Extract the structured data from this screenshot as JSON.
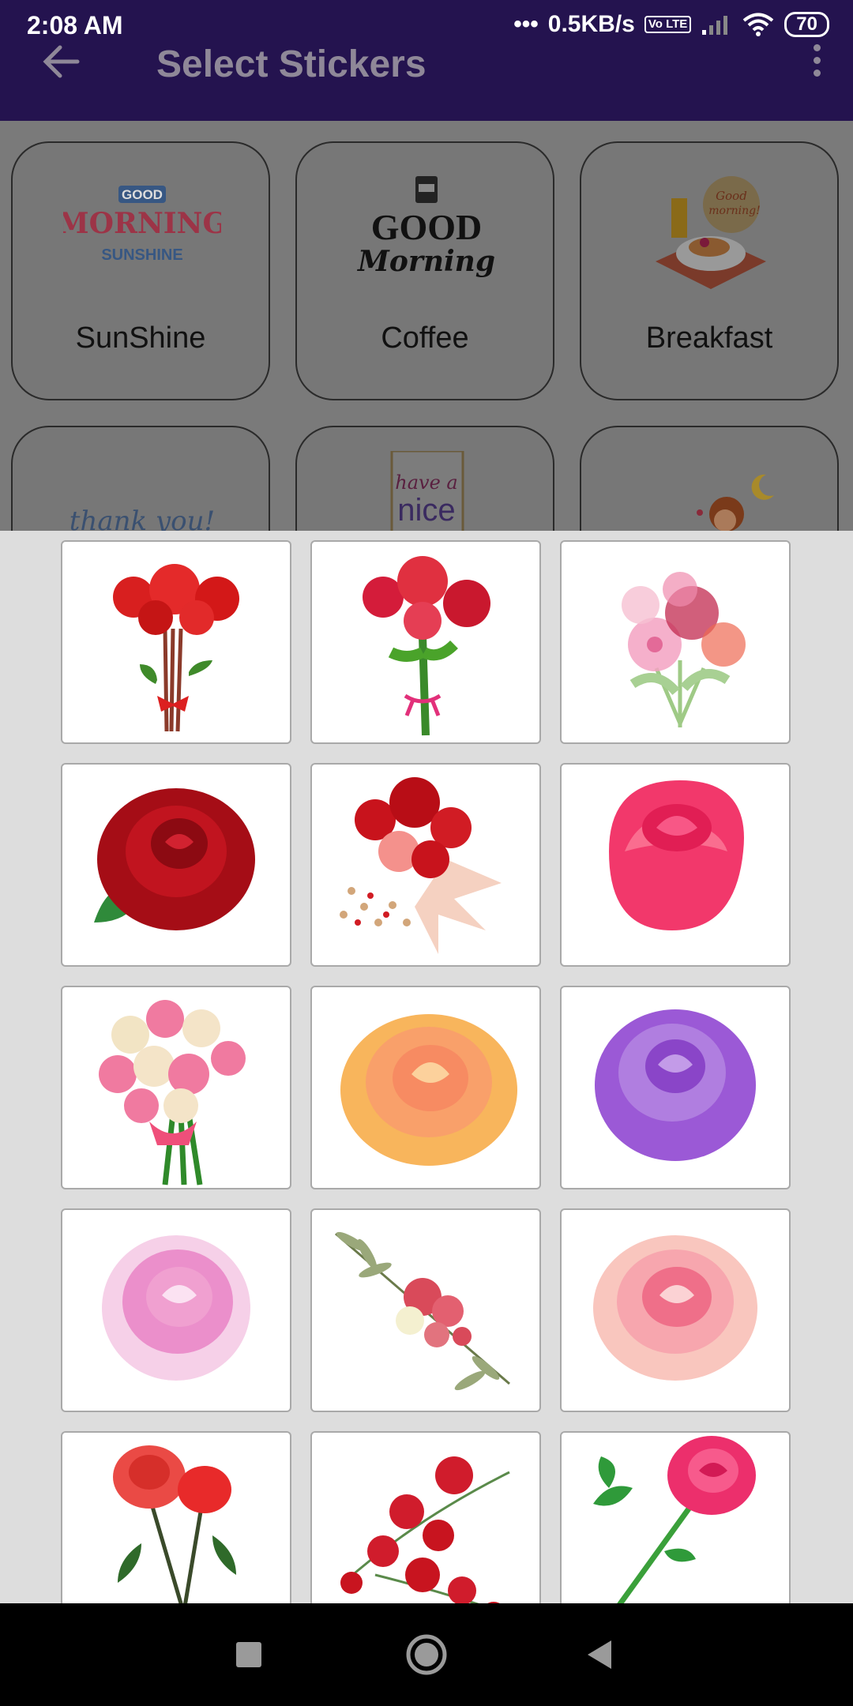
{
  "status_bar": {
    "time": "2:08 AM",
    "network_speed": "0.5KB/s",
    "volte": "Vo LTE",
    "battery": "70"
  },
  "app_bar": {
    "title": "Select Stickers",
    "back_icon": "arrow-left-icon",
    "menu_icon": "more-vert-icon"
  },
  "categories": [
    {
      "label": "SunShine",
      "art_text": [
        "GOOD",
        "MORNING",
        "SUNSHINE"
      ]
    },
    {
      "label": "Coffee",
      "art_text": [
        "GOOD",
        "Morning"
      ]
    },
    {
      "label": "Breakfast",
      "art_text": [
        "Good",
        "morning!"
      ]
    },
    {
      "label": "",
      "art_text": [
        "thank you!"
      ]
    },
    {
      "label": "",
      "art_text": [
        "have a",
        "nice"
      ]
    },
    {
      "label": "",
      "art_text": []
    }
  ],
  "stickers": [
    {
      "name": "red-roses-bouquet-ribbon",
      "color": "#e32424"
    },
    {
      "name": "red-roses-bouquet-pink-bow",
      "color": "#d81b45"
    },
    {
      "name": "watercolor-pink-bouquet",
      "color": "#f08cae"
    },
    {
      "name": "dark-red-rose",
      "color": "#a50d16"
    },
    {
      "name": "red-peach-bouquet",
      "color": "#c8131c"
    },
    {
      "name": "pink-rose-bud",
      "color": "#f2386b"
    },
    {
      "name": "pink-cream-roses-bouquet",
      "color": "#f07aa0"
    },
    {
      "name": "peach-rose",
      "color": "#fca062"
    },
    {
      "name": "purple-rose",
      "color": "#9b59d6"
    },
    {
      "name": "light-pink-rose",
      "color": "#f0a0d0"
    },
    {
      "name": "roses-with-olive-branch",
      "color": "#d94a5a"
    },
    {
      "name": "soft-pink-rose",
      "color": "#f7a6ae"
    },
    {
      "name": "two-red-roses",
      "color": "#ea4a45"
    },
    {
      "name": "red-roses-spray",
      "color": "#d01c2c"
    },
    {
      "name": "pink-rose-long-stem",
      "color": "#ec2f6c"
    }
  ],
  "nav": {
    "recents_icon": "square-icon",
    "home_icon": "circle-icon",
    "back_icon": "triangle-back-icon"
  }
}
